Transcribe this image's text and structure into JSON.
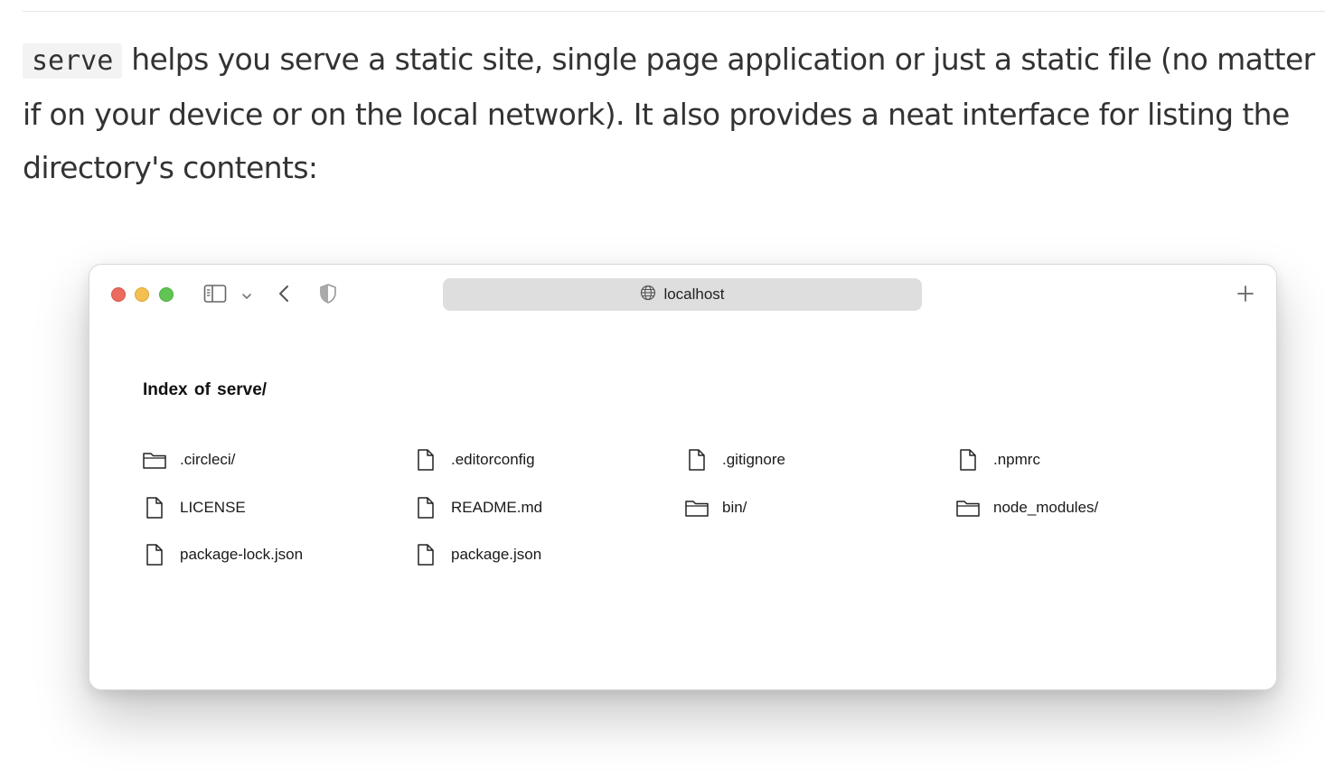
{
  "intro": {
    "code": "serve",
    "text": " helps you serve a static site, single page application or just a static file (no matter if on your device or on the local network). It also provides a neat interface for listing the directory's contents:"
  },
  "browser": {
    "url": "localhost",
    "page_title_prefix": "Index of",
    "page_title_dir": "serve/",
    "entries": [
      {
        "name": ".circleci/",
        "kind": "folder"
      },
      {
        "name": ".editorconfig",
        "kind": "file"
      },
      {
        "name": ".gitignore",
        "kind": "file"
      },
      {
        "name": ".npmrc",
        "kind": "file"
      },
      {
        "name": "LICENSE",
        "kind": "file"
      },
      {
        "name": "README.md",
        "kind": "file"
      },
      {
        "name": "bin/",
        "kind": "folder"
      },
      {
        "name": "node_modules/",
        "kind": "folder"
      },
      {
        "name": "package-lock.json",
        "kind": "file"
      },
      {
        "name": "package.json",
        "kind": "file"
      }
    ]
  },
  "icons": {
    "toolbar": [
      "sidebar-icon",
      "chevron-down-icon",
      "back-icon",
      "shield-icon",
      "globe-icon",
      "plus-icon"
    ],
    "file": "file-icon",
    "folder": "folder-icon"
  },
  "colors": {
    "close": "#ed6a5e",
    "minimize": "#f5bf4f",
    "maximize": "#61c554",
    "url_bar": "#dedede"
  }
}
